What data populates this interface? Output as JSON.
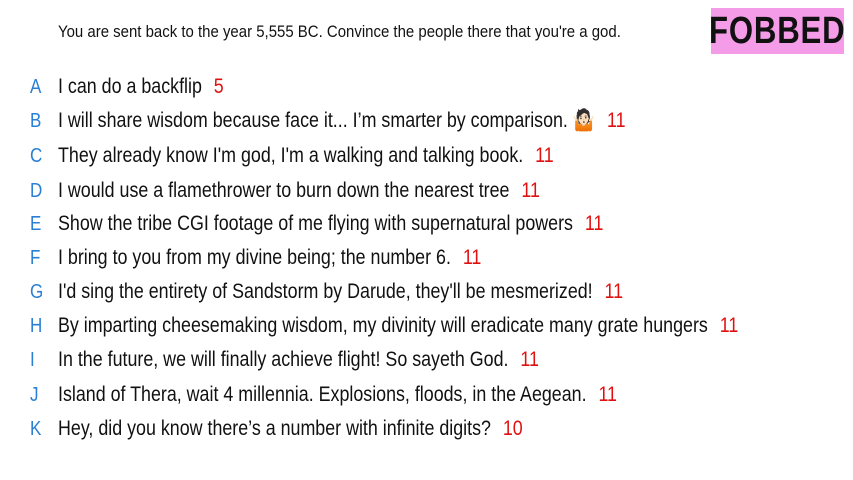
{
  "prompt": "You are sent back to the year 5,555 BC. Convince the people there that you're a god.",
  "badge": "FOBBED",
  "colors": {
    "letter": "#2a7fd4",
    "score": "#e01010",
    "badge_bg": "#f59ce8"
  },
  "answers": [
    {
      "letter": "A",
      "text": "I can do a backflip",
      "score": "5"
    },
    {
      "letter": "B",
      "text": "I will share wisdom because face it... I’m smarter by comparison. 🤷🏻",
      "score": "11"
    },
    {
      "letter": "C",
      "text": "They already know I'm god, I'm a walking and talking book.",
      "score": "11"
    },
    {
      "letter": "D",
      "text": "I would use a flamethrower to burn down the nearest tree",
      "score": "11"
    },
    {
      "letter": "E",
      "text": "Show the tribe CGI footage of me flying with supernatural powers",
      "score": "11"
    },
    {
      "letter": "F",
      "text": "I bring to you from my divine being; the number 6.",
      "score": "11"
    },
    {
      "letter": "G",
      "text": "I'd sing the entirety of Sandstorm by Darude, they'll be mesmerized!",
      "score": "11"
    },
    {
      "letter": "H",
      "text": "By imparting cheesemaking wisdom, my divinity will eradicate many grate hungers",
      "score": "11"
    },
    {
      "letter": "I",
      "text": "In the future, we will finally achieve flight! So sayeth God.",
      "score": "11"
    },
    {
      "letter": "J",
      "text": "Island of Thera, wait 4 millennia. Explosions, floods, in the Aegean.",
      "score": "11"
    },
    {
      "letter": "K",
      "text": "Hey, did you know there’s a number with infinite digits?",
      "score": "10"
    }
  ]
}
